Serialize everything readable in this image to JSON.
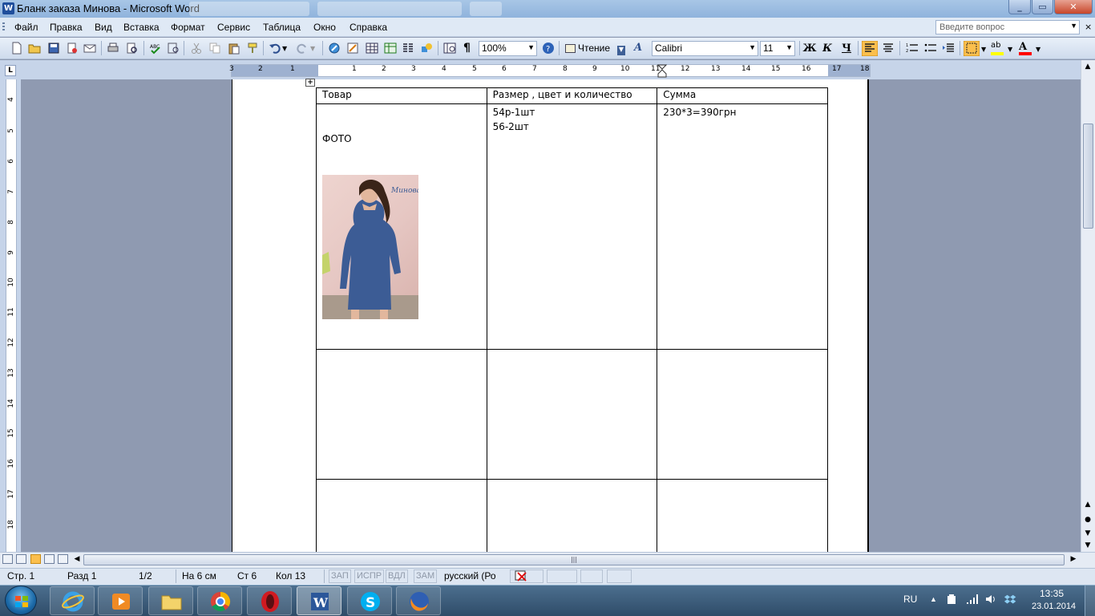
{
  "window": {
    "title": "Бланк заказа Минова - Microsoft Word",
    "app_icon": "W"
  },
  "menu": {
    "items": [
      "Файл",
      "Правка",
      "Вид",
      "Вставка",
      "Формат",
      "Сервис",
      "Таблица",
      "Окно",
      "Справка"
    ],
    "help_placeholder": "Введите вопрос",
    "close_glyph": "×"
  },
  "toolbar": {
    "zoom": "100%",
    "reading_label": "Чтение",
    "font_name": "Calibri",
    "font_size": "11",
    "bold": "Ж",
    "italic": "К",
    "underline": "Ч",
    "colors": {
      "highlight": "#ffff00",
      "font_color": "#ff0000",
      "active_align": "#fbbf4d"
    }
  },
  "ruler": {
    "corner": "L",
    "h_numbers": [
      "3",
      "2",
      "1",
      "1",
      "2",
      "3",
      "4",
      "5",
      "6",
      "7",
      "8",
      "9",
      "10",
      "11",
      "12",
      "13",
      "14",
      "15",
      "16",
      "17",
      "18"
    ],
    "v_numbers": [
      "4",
      "5",
      "6",
      "7",
      "8",
      "9",
      "10",
      "11",
      "12",
      "13",
      "14",
      "15",
      "16",
      "17",
      "18"
    ]
  },
  "table": {
    "headers": [
      "Товар",
      "Размер , цвет и количество",
      "Сумма"
    ],
    "row1": {
      "product_label": "ФОТО",
      "size_lines": [
        "54р-1шт",
        "56-2шт"
      ],
      "sum": "230*3=390грн"
    },
    "photo_watermark": "Минова"
  },
  "status": {
    "page": "Стр. 1",
    "section": "Разд 1",
    "pages": "1/2",
    "at": "На 6 см",
    "line": "Ст 6",
    "col": "Кол 13",
    "rec": "ЗАП",
    "trk": "ИСПР",
    "ext": "ВДЛ",
    "ovr": "ЗАМ",
    "language": "русский (Ро"
  },
  "taskbar": {
    "lang": "RU",
    "time": "13:35",
    "date": "23.01.2014"
  }
}
